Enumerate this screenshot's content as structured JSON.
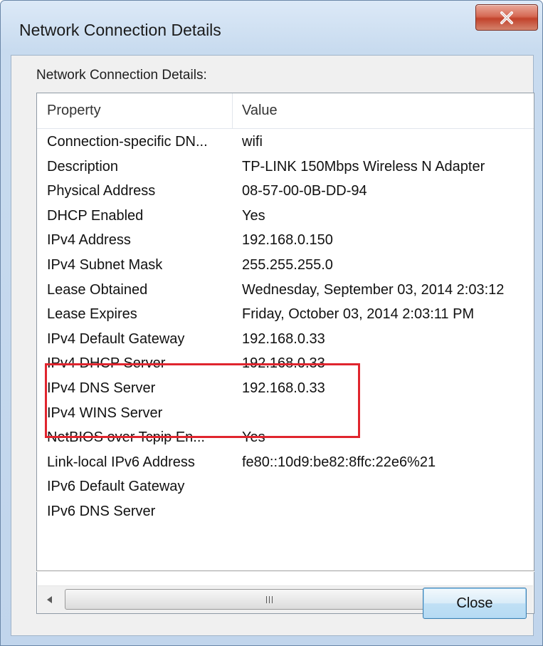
{
  "window": {
    "title": "Network Connection Details"
  },
  "group_label": "Network Connection Details:",
  "columns": {
    "property": "Property",
    "value": "Value"
  },
  "rows": [
    {
      "property": "Connection-specific DN...",
      "value": "wifi"
    },
    {
      "property": "Description",
      "value": "TP-LINK 150Mbps Wireless N Adapter"
    },
    {
      "property": "Physical Address",
      "value": "08-57-00-0B-DD-94"
    },
    {
      "property": "DHCP Enabled",
      "value": "Yes"
    },
    {
      "property": "IPv4 Address",
      "value": "192.168.0.150"
    },
    {
      "property": "IPv4 Subnet Mask",
      "value": "255.255.255.0"
    },
    {
      "property": "Lease Obtained",
      "value": "Wednesday, September 03, 2014 2:03:12"
    },
    {
      "property": "Lease Expires",
      "value": "Friday, October 03, 2014 2:03:11 PM"
    },
    {
      "property": "IPv4 Default Gateway",
      "value": "192.168.0.33"
    },
    {
      "property": "IPv4 DHCP Server",
      "value": "192.168.0.33"
    },
    {
      "property": "IPv4 DNS Server",
      "value": "192.168.0.33"
    },
    {
      "property": "IPv4 WINS Server",
      "value": ""
    },
    {
      "property": "NetBIOS over Tcpip En...",
      "value": "Yes"
    },
    {
      "property": "Link-local IPv6 Address",
      "value": "fe80::10d9:be82:8ffc:22e6%21"
    },
    {
      "property": "IPv6 Default Gateway",
      "value": ""
    },
    {
      "property": "IPv6 DNS Server",
      "value": ""
    }
  ],
  "scrollbar": {
    "left_icon": "scroll-left-arrow",
    "right_icon": "scroll-right-arrow",
    "thumb_icon": "grip"
  },
  "buttons": {
    "close_label": "Close",
    "close_icon": "close-x-icon"
  },
  "colors": {
    "highlight": "#e0252e",
    "close_caption": "#c2432c"
  }
}
